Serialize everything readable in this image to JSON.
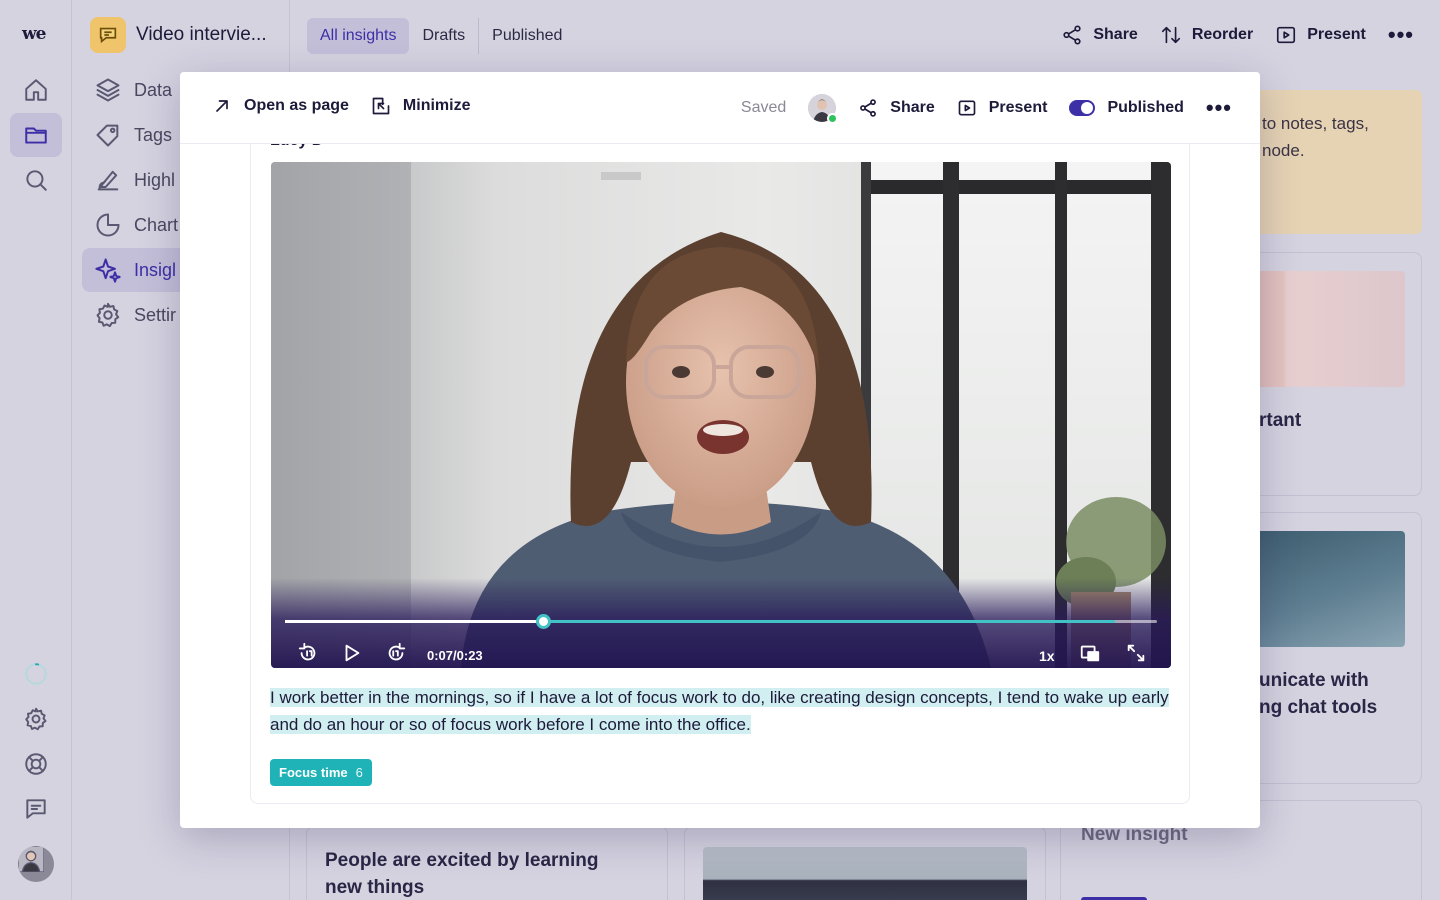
{
  "rail": {
    "logo": "we",
    "icons": [
      "home-icon",
      "folder-icon",
      "search-icon",
      "loading-spinner-icon",
      "gear-icon",
      "help-lifebuoy-icon",
      "message-icon"
    ]
  },
  "sidebar": {
    "project_name": "Video intervie...",
    "items": [
      {
        "label": "Data",
        "icon": "layers-icon"
      },
      {
        "label": "Tags",
        "icon": "tag-icon"
      },
      {
        "label": "Highl",
        "icon": "highlighter-icon"
      },
      {
        "label": "Chart",
        "icon": "pie-chart-icon"
      },
      {
        "label": "Insigl",
        "icon": "sparkles-icon",
        "active": true
      },
      {
        "label": "Settir",
        "icon": "gear-icon"
      }
    ]
  },
  "topbar": {
    "tabs": [
      "All insights",
      "Drafts",
      "Published"
    ],
    "actions": {
      "share": "Share",
      "reorder": "Reorder",
      "present": "Present"
    }
  },
  "background": {
    "note_text_1": "to notes, tags,",
    "note_text_2": "node.",
    "card_title_1": "rtant",
    "card_title_2a": "unicate with",
    "card_title_2b": "ng chat tools",
    "card_title_3a": "People are excited by learning",
    "card_title_3b": "new things",
    "card_title_4": "New insight"
  },
  "modal": {
    "open_as_page": "Open as page",
    "minimize": "Minimize",
    "saved": "Saved",
    "share": "Share",
    "present": "Present",
    "published": "Published",
    "clip_name": "Lucy D",
    "video": {
      "time": "0:07/0:23",
      "speed": "1x",
      "played_fraction": 0.296,
      "highlight_start_fraction": 0.195,
      "highlight_end_fraction": 0.952
    },
    "transcript": "I work better in the mornings, so if I have a lot of focus work to do, like creating design concepts, I tend to wake up early and do an hour or so of focus work before I come into the office.",
    "tag": {
      "label": "Focus time",
      "count": "6",
      "color": "#1fb3b8"
    }
  },
  "colors": {
    "accent": "#3c2fa6",
    "teal": "#41c3c6",
    "background": "#d5d3e0"
  }
}
